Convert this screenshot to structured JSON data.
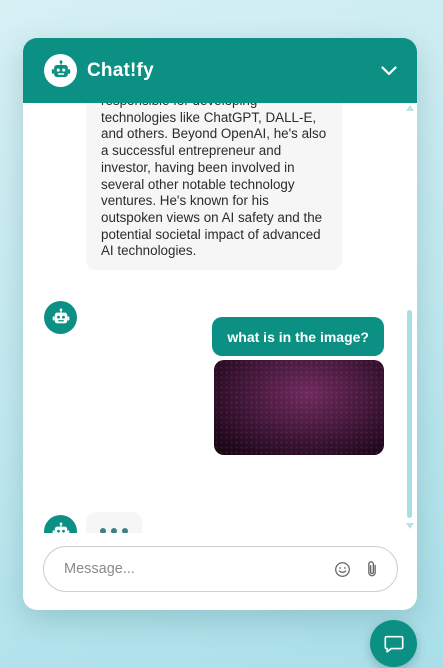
{
  "header": {
    "title": "Chat!fy",
    "logo_icon": "robot-icon",
    "collapse_icon": "chevron-down-icon"
  },
  "messages": {
    "bot_message": "responsible for developing technologies like ChatGPT, DALL-E, and others. Beyond OpenAI, he's also a successful entrepreneur and investor, having been involved in several other notable technology ventures. He's known for his outspoken views on AI safety and the potential societal impact of advanced AI technologies.",
    "user_message": "what is in the image?",
    "user_attachment": "image",
    "typing_indicator": "three-dots"
  },
  "composer": {
    "placeholder": "Message...",
    "emoji_icon": "emoji-icon",
    "attach_icon": "paperclip-icon"
  },
  "launcher": {
    "icon": "chat-bubble-icon"
  },
  "colors": {
    "primary": "#0b9083",
    "bubble_bg": "#f6f6f6",
    "page_bg": "#c4eaf0"
  }
}
